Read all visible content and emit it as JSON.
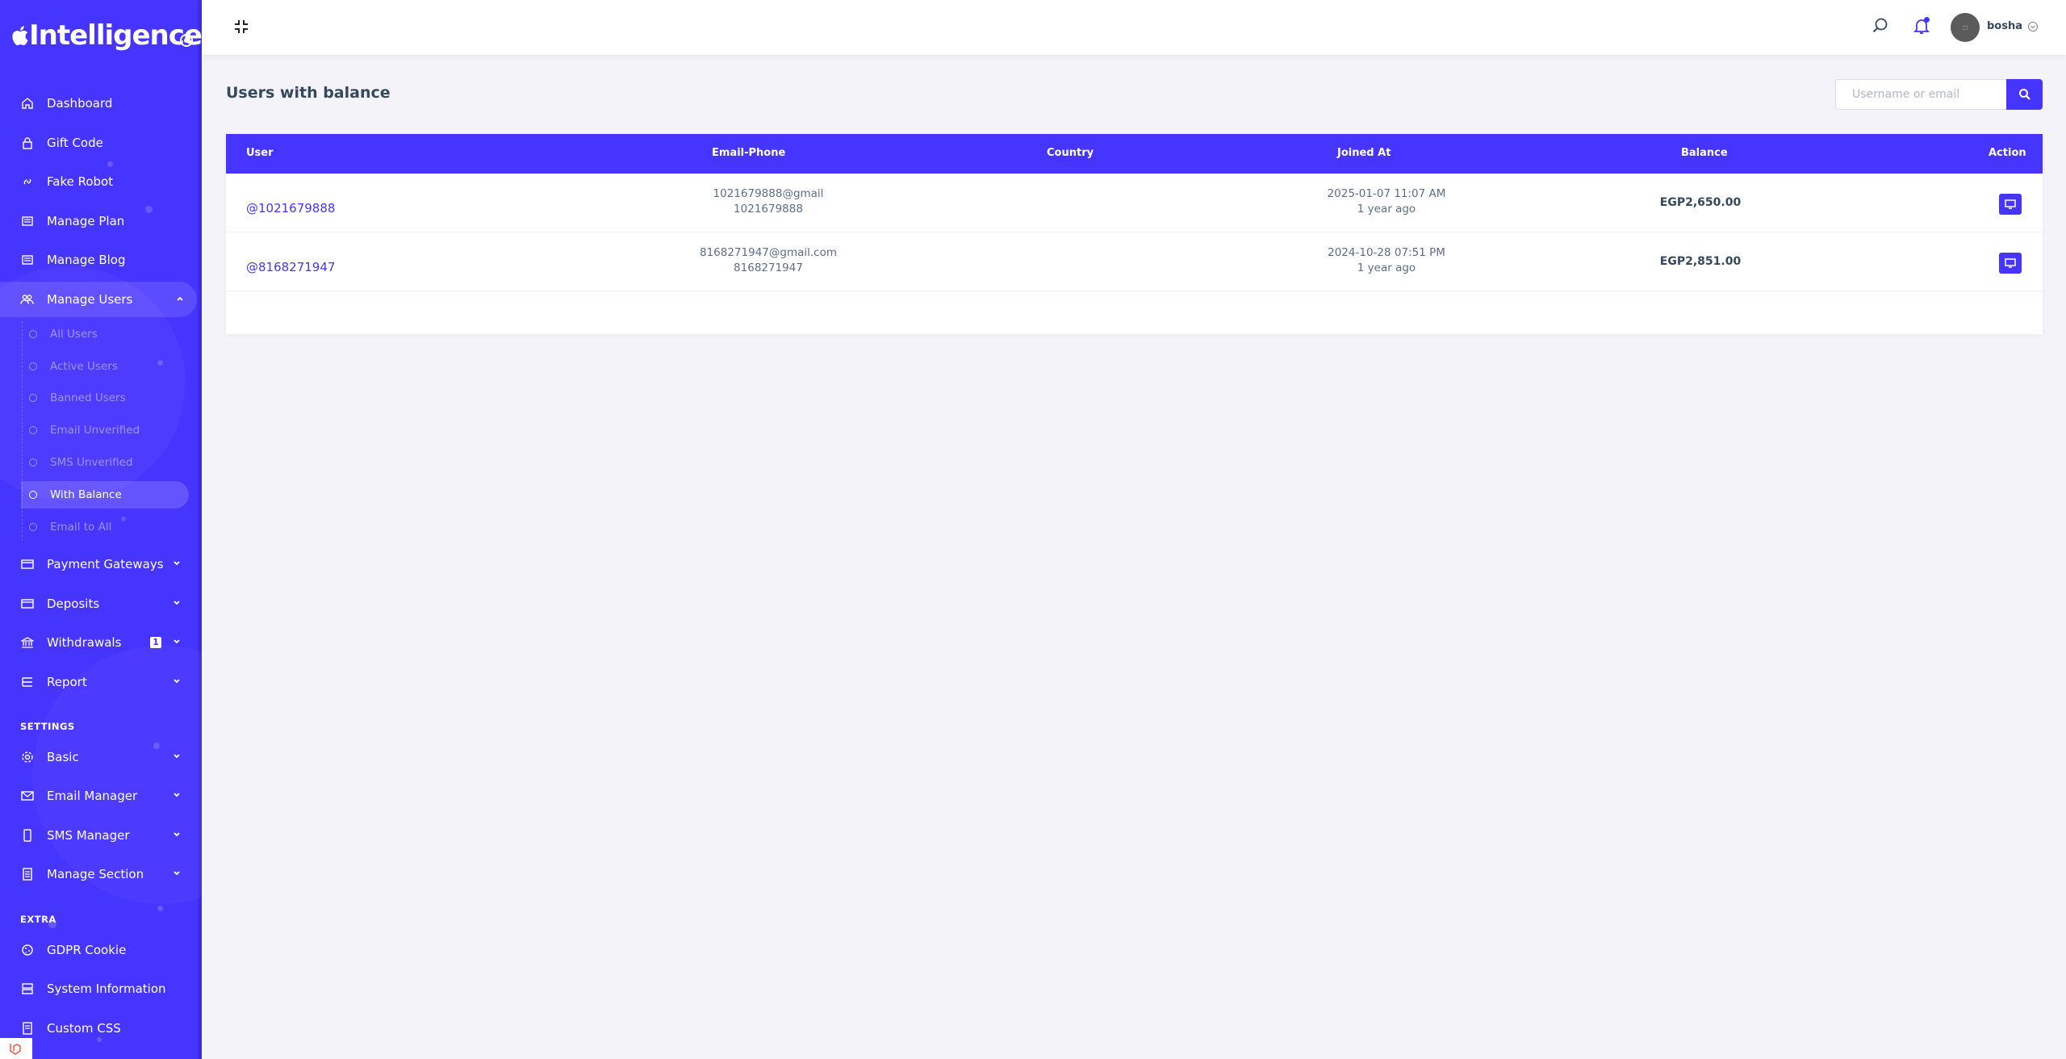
{
  "brand": {
    "name": "Intelligence"
  },
  "sidebar": {
    "items": [
      {
        "label": "Dashboard",
        "icon": "home-icon"
      },
      {
        "label": "Gift Code",
        "icon": "lock-icon"
      },
      {
        "label": "Fake Robot",
        "icon": "link-icon"
      },
      {
        "label": "Manage Plan",
        "icon": "list-icon"
      },
      {
        "label": "Manage Blog",
        "icon": "list-icon"
      },
      {
        "label": "Manage Users",
        "icon": "users-icon"
      }
    ],
    "sub_items": [
      {
        "label": "All Users"
      },
      {
        "label": "Active Users"
      },
      {
        "label": "Banned Users"
      },
      {
        "label": "Email Unverified"
      },
      {
        "label": "SMS Unverified"
      },
      {
        "label": "With Balance"
      },
      {
        "label": "Email to All"
      }
    ],
    "items_after": [
      {
        "label": "Payment Gateways",
        "icon": "credit-card-icon"
      },
      {
        "label": "Deposits",
        "icon": "credit-card-icon"
      },
      {
        "label": "Withdrawals",
        "icon": "bank-icon",
        "badge": "1"
      },
      {
        "label": "Report",
        "icon": "list-icon"
      }
    ],
    "settings_title": "SETTINGS",
    "settings_items": [
      {
        "label": "Basic",
        "icon": "gear-icon"
      },
      {
        "label": "Email Manager",
        "icon": "envelope-icon"
      },
      {
        "label": "SMS Manager",
        "icon": "mobile-icon"
      },
      {
        "label": "Manage Section",
        "icon": "file-icon"
      }
    ],
    "extra_title": "EXTRA",
    "extra_items": [
      {
        "label": "GDPR Cookie",
        "icon": "cookie-icon"
      },
      {
        "label": "System Information",
        "icon": "server-icon"
      },
      {
        "label": "Custom CSS",
        "icon": "file-icon"
      }
    ]
  },
  "topbar": {
    "username": "bosha"
  },
  "page": {
    "title": "Users with balance",
    "search_placeholder": "Username or email"
  },
  "table": {
    "headers": [
      "User",
      "Email-Phone",
      "Country",
      "Joined At",
      "Balance",
      "Action"
    ],
    "rows": [
      {
        "username": "@1021679888",
        "email": "1021679888@gmail",
        "phone": "1021679888",
        "country": "",
        "joined_date": "2025-01-07 11:07 AM",
        "joined_ago": "1 year ago",
        "balance": "EGP2,650.00"
      },
      {
        "username": "@8168271947",
        "email": "8168271947@gmail.com",
        "phone": "8168271947",
        "country": "",
        "joined_date": "2024-10-28 07:51 PM",
        "joined_ago": "1 year ago",
        "balance": "EGP2,851.00"
      }
    ]
  },
  "colors": {
    "primary": "#4634ff",
    "background": "#f3f3f9",
    "text": "#5b6e88"
  }
}
